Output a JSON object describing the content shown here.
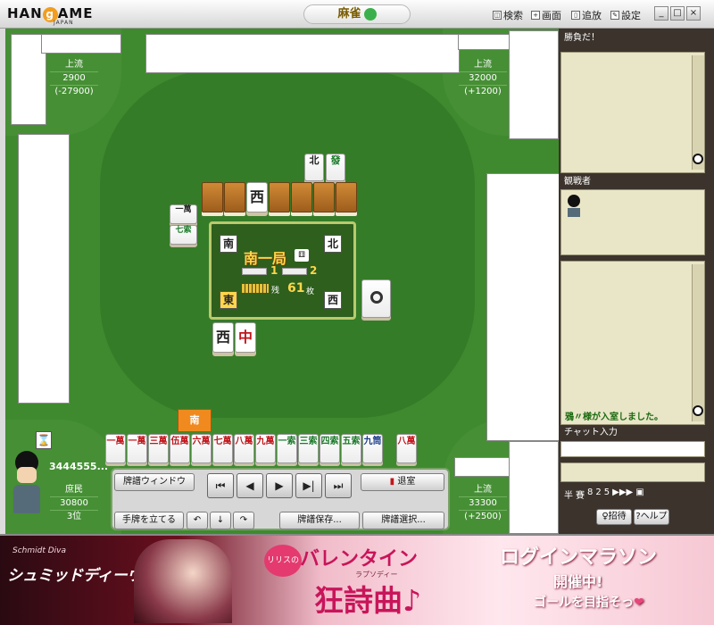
{
  "app": {
    "brand": "HANGAME",
    "brand_sub": "JAPAN",
    "title": "麻雀"
  },
  "menu": [
    {
      "label": "検索",
      "icon": "search-icon"
    },
    {
      "label": "画面",
      "icon": "screen-icon"
    },
    {
      "label": "追放",
      "icon": "kick-icon"
    },
    {
      "label": "設定",
      "icon": "settings-icon"
    }
  ],
  "window_buttons": [
    "_",
    "□",
    "×"
  ],
  "players": {
    "top_left": {
      "rank": "上流",
      "score": "2900",
      "diff": "(-27900)"
    },
    "top_right": {
      "rank": "上流",
      "score": "32000",
      "diff": "(+1200)"
    },
    "bottom_right": {
      "rank": "上流",
      "score": "33300",
      "diff": "(+2500)"
    },
    "self": {
      "id": "3444555...",
      "rank": "庶民",
      "score": "30800",
      "place": "3位"
    }
  },
  "center": {
    "round": "南一局",
    "honba": "1",
    "riichi": "2",
    "remain_label": "残",
    "remain": "61",
    "remain_unit": "枚",
    "seats": {
      "top": "北",
      "right": "西",
      "bottom": "東",
      "left": "南"
    }
  },
  "turn_indicator": "南",
  "discards": {
    "top": [
      "北",
      "發"
    ],
    "left": [
      "一萬",
      "七索"
    ],
    "center_bottom": [
      "西",
      "中"
    ],
    "wall_tile": "西"
  },
  "hand": [
    "一萬",
    "一萬",
    "三萬",
    "伍萬",
    "六萬",
    "七萬",
    "八萬",
    "九萬",
    "一索",
    "三索",
    "四索",
    "五索",
    "九筒",
    "八萬"
  ],
  "controls": {
    "log_window": "牌譜ウィンドウ",
    "exit": "退室",
    "stand_hand": "手牌を立てる",
    "save_log": "牌譜保存...",
    "select_log": "牌譜選択...",
    "playback": [
      "⏮",
      "◀",
      "▶",
      "▶|",
      "⏭"
    ]
  },
  "right_panel": {
    "header": "勝負だ！",
    "spectators": "観戦者",
    "chat_message": "鴉〃様が入室しました。",
    "chat_input": "チャット入力",
    "icons_row": [
      "半",
      "賽",
      "8",
      "2",
      "5",
      "▶▶▶",
      "▣"
    ],
    "invite": "招待",
    "help": "ヘルプ"
  },
  "banner": {
    "game_title": "Schmidt Diva",
    "game_title_jp": "シュミッドディーヴァ",
    "badge": "リリスの",
    "headline": "バレンタイン",
    "subline": "狂詩曲♪",
    "ruby": "ラプソディー",
    "campaign": "ログインマラソン",
    "campaign_sub": "開催中!",
    "goal": "ゴールを目指そっ"
  },
  "colors": {
    "felt": "#3f8a2f",
    "gold": "#ffd64a",
    "red_tile": "#c0161c",
    "panel": "#3b332c"
  }
}
